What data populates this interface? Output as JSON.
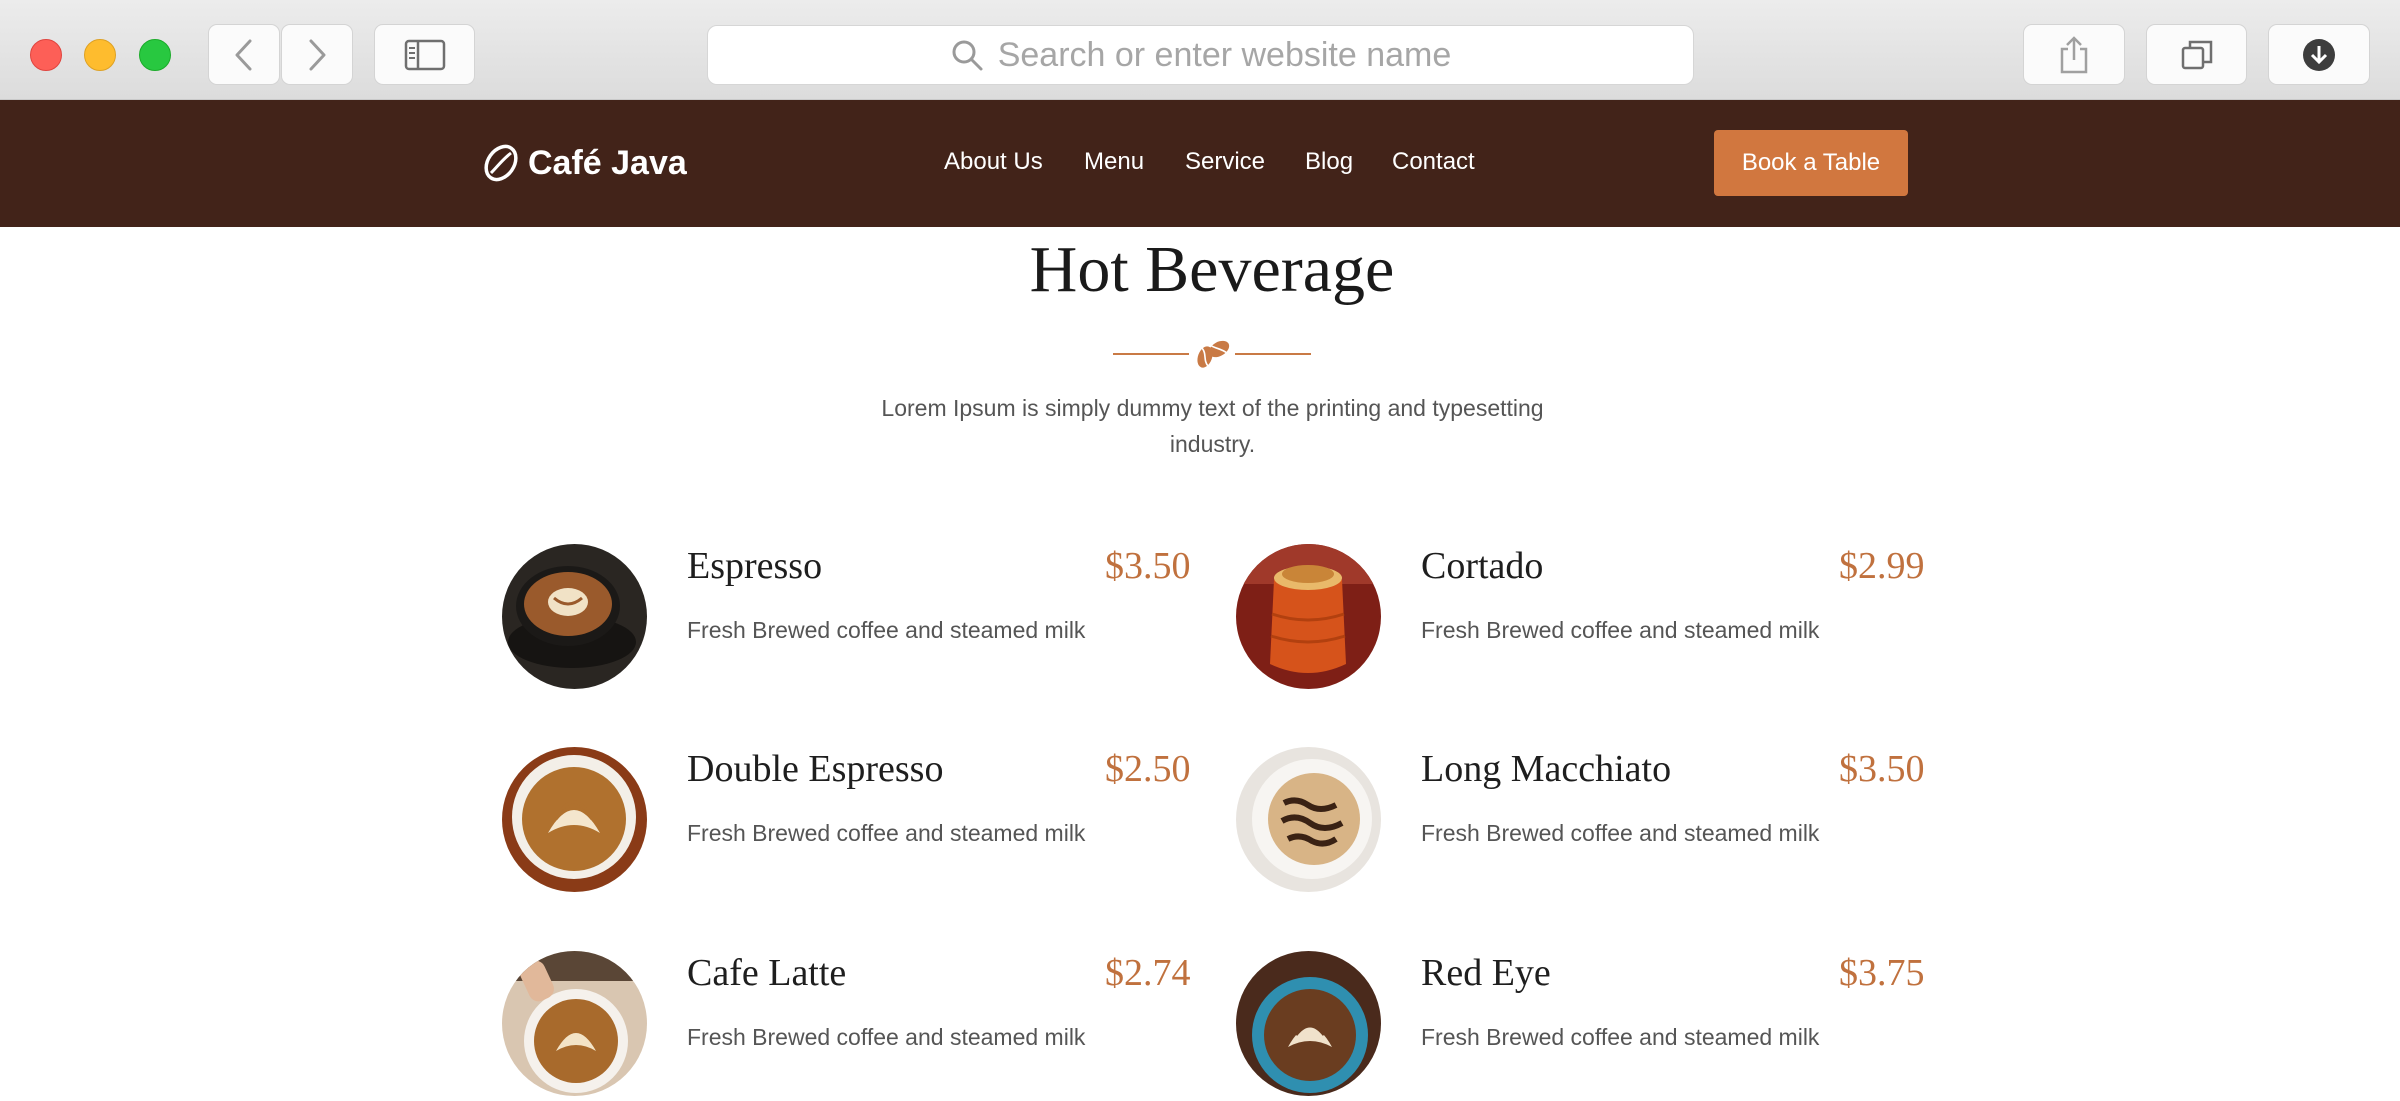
{
  "browser": {
    "address_placeholder": "Search or enter website name",
    "icons": [
      "back-arrow-icon",
      "forward-arrow-icon",
      "sidebar-icon",
      "search-icon",
      "share-icon",
      "tabs-icon",
      "download-icon"
    ]
  },
  "header": {
    "logo_text": "Café Java",
    "nav": [
      "About Us",
      "Menu",
      "Service",
      "Blog",
      "Contact"
    ],
    "cta_label": "Book a Table",
    "colors": {
      "header_bg": "#422319",
      "accent": "#d1773f"
    }
  },
  "section": {
    "title": "Hot Beverage",
    "intro": "Lorem Ipsum is simply dummy text of the printing and typesetting industry."
  },
  "menu": [
    {
      "name": "Espresso",
      "price": "$3.50",
      "desc": "Fresh Brewed coffee and steamed milk"
    },
    {
      "name": "Cortado",
      "price": "$2.99",
      "desc": "Fresh Brewed coffee and steamed milk"
    },
    {
      "name": "Double Espresso",
      "price": "$2.50",
      "desc": "Fresh Brewed coffee and steamed milk"
    },
    {
      "name": "Long Macchiato",
      "price": "$3.50",
      "desc": "Fresh Brewed coffee and steamed milk"
    },
    {
      "name": "Cafe Latte",
      "price": "$2.74",
      "desc": "Fresh Brewed coffee and steamed milk"
    },
    {
      "name": "Red Eye",
      "price": "$3.75",
      "desc": "Fresh Brewed coffee and steamed milk"
    }
  ]
}
